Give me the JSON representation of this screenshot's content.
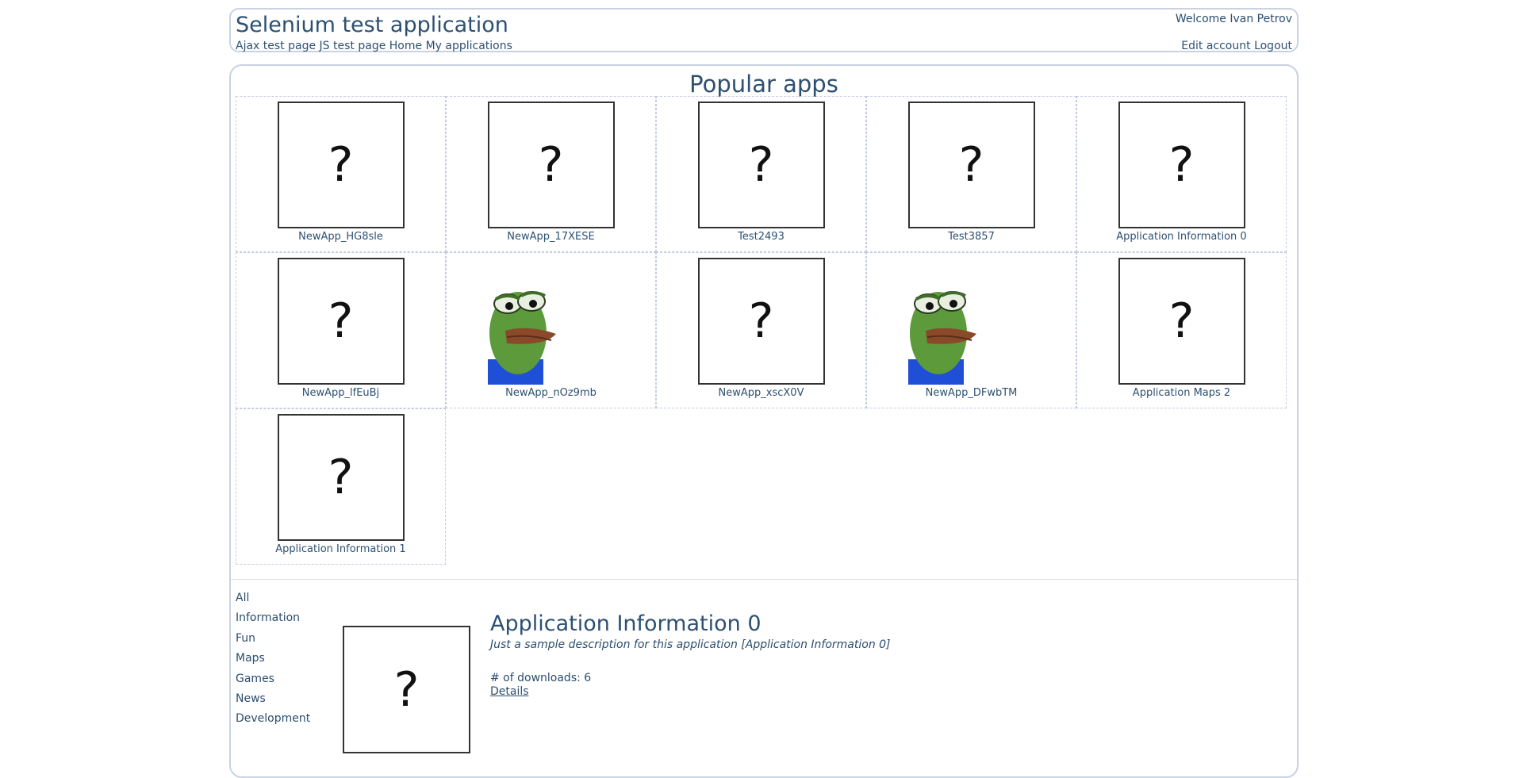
{
  "header": {
    "title": "Selenium test application",
    "nav": [
      "Ajax test page",
      "JS test page",
      "Home",
      "My applications"
    ],
    "welcome": "Welcome Ivan Petrov",
    "account_links": [
      "Edit account",
      "Logout"
    ]
  },
  "popular": {
    "title": "Popular apps",
    "apps": [
      {
        "name": "NewApp_HG8sle",
        "icon": "question-mark"
      },
      {
        "name": "NewApp_17XESE",
        "icon": "question-mark"
      },
      {
        "name": "Test2493",
        "icon": "question-mark"
      },
      {
        "name": "Test3857",
        "icon": "question-mark"
      },
      {
        "name": "Application Information 0",
        "icon": "question-mark"
      },
      {
        "name": "NewApp_lfEuBj",
        "icon": "question-mark"
      },
      {
        "name": "NewApp_nOz9mb",
        "icon": "sad-frog"
      },
      {
        "name": "NewApp_xscX0V",
        "icon": "question-mark"
      },
      {
        "name": "NewApp_DFwbTM",
        "icon": "sad-frog"
      },
      {
        "name": "Application Maps 2",
        "icon": "question-mark"
      },
      {
        "name": "Application Information 1",
        "icon": "question-mark"
      }
    ]
  },
  "categories": [
    "All",
    "Information",
    "Fun",
    "Maps",
    "Games",
    "News",
    "Development"
  ],
  "featured": {
    "title": "Application Information 0",
    "description": "Just a sample description for this application [Application Information 0]",
    "downloads": "# of downloads: 6",
    "details_label": "Details",
    "icon": "question-mark"
  },
  "placeholder_glyph": "?",
  "colors": {
    "text": "#2d5072",
    "border": "#c9d2e2",
    "frog_green": "#5c9a3c",
    "frog_lip": "#8a4a2a",
    "shirt_blue": "#1f4fd6"
  }
}
